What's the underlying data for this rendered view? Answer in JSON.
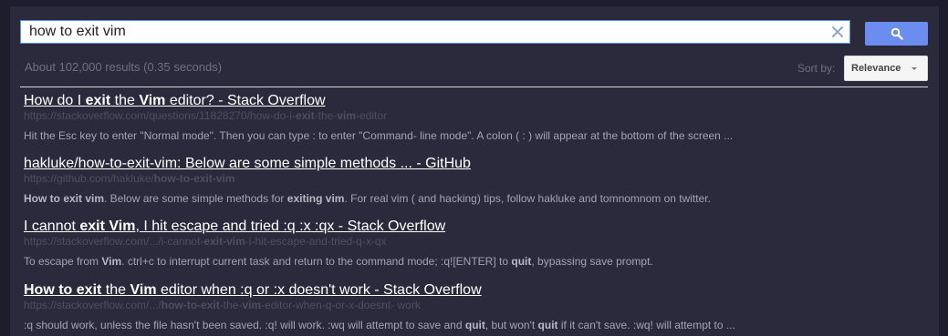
{
  "search": {
    "query": "how to exit vim"
  },
  "stats": "About 102,000 results (0.35 seconds)",
  "sort": {
    "label": "Sort by:",
    "selected": "Relevance"
  },
  "icons": {
    "clear": "close-icon",
    "search": "search-icon",
    "dropdown": "caret-down-icon"
  },
  "colors": {
    "background": "#1e1d2d",
    "panel": "#2b2a3d",
    "search_button": "#6b8df0",
    "title": "#ffffff",
    "url": "#4e4e5e",
    "snippet": "#a3a3b0"
  },
  "results": [
    {
      "title": [
        {
          "t": "How do I ",
          "b": false
        },
        {
          "t": "exit",
          "b": true
        },
        {
          "t": " the ",
          "b": false
        },
        {
          "t": "Vim",
          "b": true
        },
        {
          "t": " editor? - Stack Overflow",
          "b": false
        }
      ],
      "url": [
        {
          "t": "https://stackoverflow.com/questions/11828270/how-do-i-",
          "b": false
        },
        {
          "t": "exit",
          "b": true
        },
        {
          "t": "-the-",
          "b": false
        },
        {
          "t": "vim",
          "b": true
        },
        {
          "t": "-editor",
          "b": false
        }
      ],
      "snippet": [
        {
          "t": "Hit the Esc key to enter \"Normal mode\". Then you can type : to enter \"Command- line mode\". A colon ( : ) will appear at the bottom of the screen ...",
          "b": false
        }
      ]
    },
    {
      "title": [
        {
          "t": "hakluke/how-to-exit-vim: Below are some simple methods ... - GitHub",
          "b": false
        }
      ],
      "url": [
        {
          "t": "https://github.com/hakluke/",
          "b": false
        },
        {
          "t": "how-to-exit-vim",
          "b": true
        }
      ],
      "snippet": [
        {
          "t": "How to exit vim",
          "b": true
        },
        {
          "t": ". Below are some simple methods for ",
          "b": false
        },
        {
          "t": "exiting vim",
          "b": true
        },
        {
          "t": ". For real vim ( and hacking) tips, follow hakluke and tomnomnom on twitter.",
          "b": false
        }
      ]
    },
    {
      "title": [
        {
          "t": "I cannot ",
          "b": false
        },
        {
          "t": "exit Vim",
          "b": true
        },
        {
          "t": ", I hit escape and tried :q :x :qx - Stack Overflow",
          "b": false
        }
      ],
      "url": [
        {
          "t": "https://stackoverflow.com/.../i-cannot-",
          "b": false
        },
        {
          "t": "exit-vim",
          "b": true
        },
        {
          "t": "-i-hit-escape-and-tried-q-x-qx",
          "b": false
        }
      ],
      "snippet": [
        {
          "t": "To escape from ",
          "b": false
        },
        {
          "t": "Vim",
          "b": true
        },
        {
          "t": ". ctrl+c to interrupt current task and return to the command mode; :q![ENTER] to ",
          "b": false
        },
        {
          "t": "quit",
          "b": true
        },
        {
          "t": ", bypassing save prompt.",
          "b": false
        }
      ]
    },
    {
      "title": [
        {
          "t": "How to exit",
          "b": true
        },
        {
          "t": " the ",
          "b": false
        },
        {
          "t": "Vim",
          "b": true
        },
        {
          "t": " editor when :q or :x doesn't work - Stack Overflow",
          "b": false
        }
      ],
      "url": [
        {
          "t": "https://stackoverflow.com/.../",
          "b": false
        },
        {
          "t": "how-to-exit",
          "b": true
        },
        {
          "t": "-the-",
          "b": false
        },
        {
          "t": "vim",
          "b": true
        },
        {
          "t": "-editor-when-q-or-x-doesnt- work",
          "b": false
        }
      ],
      "snippet": [
        {
          "t": ":q should work, unless the file hasn't been saved. :q! will work. :wq will attempt to save and ",
          "b": false
        },
        {
          "t": "quit",
          "b": true
        },
        {
          "t": ", but won't ",
          "b": false
        },
        {
          "t": "quit",
          "b": true
        },
        {
          "t": " if it can't save. :wq! will attempt to ...",
          "b": false
        }
      ]
    }
  ]
}
